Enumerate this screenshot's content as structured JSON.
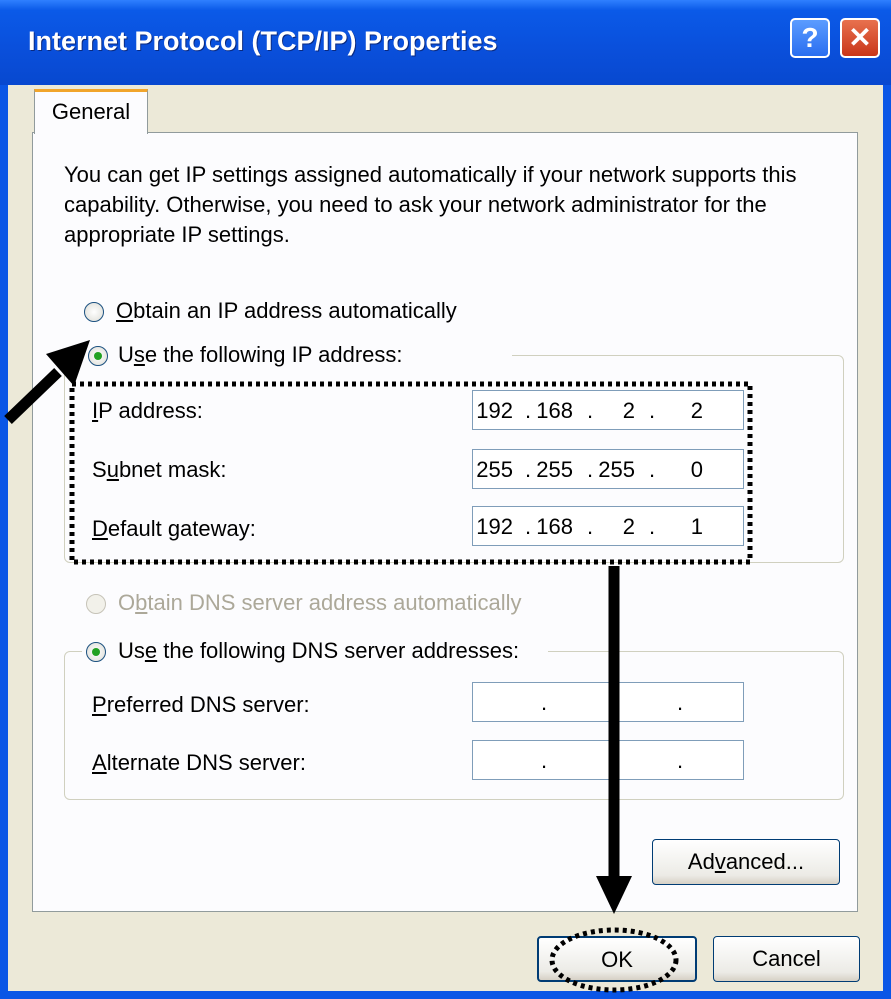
{
  "window": {
    "title": "Internet Protocol (TCP/IP) Properties",
    "help_glyph": "?",
    "close_glyph": "✕"
  },
  "tabs": [
    {
      "label": "General",
      "selected": true
    }
  ],
  "intro_text": "You can get IP settings assigned automatically if your network supports this capability. Otherwise, you need to ask your network administrator for the appropriate IP settings.",
  "ip_mode": {
    "auto": {
      "pre": "",
      "key": "O",
      "post": "btain an IP address automatically",
      "selected": false
    },
    "manual": {
      "pre": "U",
      "key": "s",
      "post": "e the following IP address:",
      "selected": true
    }
  },
  "ip_fields": [
    {
      "pre": "",
      "key": "I",
      "post": "P address:",
      "octets": [
        "192",
        "168",
        "2",
        "2"
      ]
    },
    {
      "pre": "S",
      "key": "u",
      "post": "bnet mask:",
      "octets": [
        "255",
        "255",
        "255",
        "0"
      ]
    },
    {
      "pre": "",
      "key": "D",
      "post": "efault gateway:",
      "octets": [
        "192",
        "168",
        "2",
        "1"
      ]
    }
  ],
  "dns_mode": {
    "auto": {
      "pre": "O",
      "key": "b",
      "post": "tain DNS server address automatically",
      "selected": false,
      "disabled": true
    },
    "manual": {
      "pre": "Us",
      "key": "e",
      "post": " the following DNS server addresses:",
      "selected": true
    }
  },
  "dns_fields": [
    {
      "pre": "",
      "key": "P",
      "post": "referred DNS server:",
      "octets": [
        "",
        "",
        "",
        ""
      ]
    },
    {
      "pre": "",
      "key": "A",
      "post": "lternate DNS server:",
      "octets": [
        "",
        "",
        "",
        ""
      ]
    }
  ],
  "buttons": {
    "advanced": {
      "pre": "Ad",
      "key": "v",
      "post": "anced..."
    },
    "ok": "OK",
    "cancel": "Cancel"
  },
  "colors": {
    "titlebar": "#0a50dc",
    "dialog_bg": "#ece9d8",
    "annotation": "#000000"
  }
}
